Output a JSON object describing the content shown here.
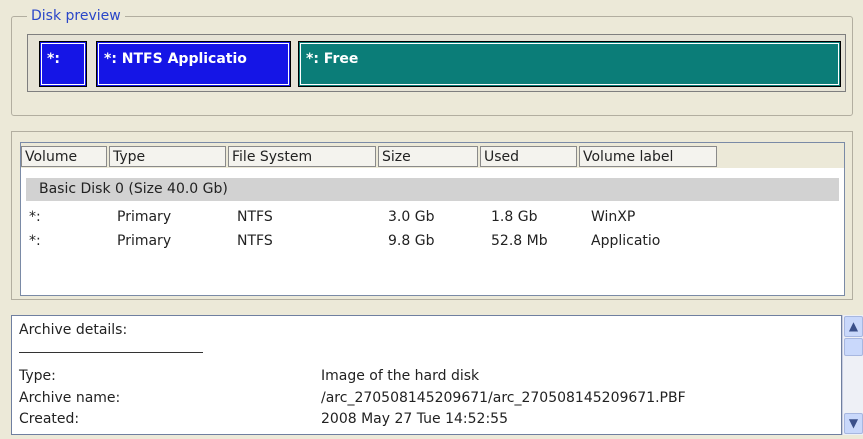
{
  "disk_preview": {
    "title": "Disk preview",
    "segments": [
      {
        "label": "*:",
        "color": "#1515e6"
      },
      {
        "label": "*: NTFS Applicatio",
        "color": "#1515e6"
      },
      {
        "label": "*: Free",
        "color": "#0b7d78"
      }
    ]
  },
  "volume_table": {
    "columns": [
      "Volume",
      "Type",
      "File System",
      "Size",
      "Used",
      "Volume label"
    ],
    "group_label": "Basic Disk 0 (Size 40.0 Gb)",
    "rows": [
      {
        "volume": "*:",
        "type": "Primary",
        "fs": "NTFS",
        "size": "3.0 Gb",
        "used": "1.8 Gb",
        "label": "WinXP"
      },
      {
        "volume": "*:",
        "type": "Primary",
        "fs": "NTFS",
        "size": "9.8 Gb",
        "used": "52.8 Mb",
        "label": "Applicatio"
      }
    ]
  },
  "archive_details": {
    "title": "Archive details:",
    "fields": [
      {
        "label": "Type:",
        "value": "Image of the hard disk"
      },
      {
        "label": "Archive name:",
        "value": "/arc_270508145209671/arc_270508145209671.PBF"
      },
      {
        "label": "Created:",
        "value": "2008 May 27 Tue 14:52:55"
      }
    ]
  },
  "scrollbar": {
    "up_icon": "▲",
    "down_icon": "▼"
  }
}
